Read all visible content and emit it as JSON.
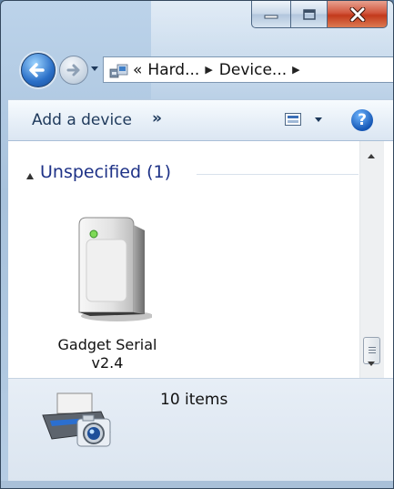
{
  "window": {
    "caption_buttons": {
      "minimize_icon": "minimize-icon",
      "maximize_icon": "maximize-icon",
      "close_icon": "close-icon",
      "close_color": "#c8432a"
    }
  },
  "navigation": {
    "back_icon": "back-arrow-icon",
    "forward_icon": "forward-arrow-icon",
    "history_icon": "dropdown-arrow-icon"
  },
  "address_bar": {
    "overflow_marker": "«",
    "breadcrumbs": [
      "Hard...",
      "Device..."
    ],
    "separator": "▶"
  },
  "toolbar": {
    "add_device_label": "Add a device",
    "more_label": "»",
    "view_icon": "change-view-icon",
    "help_icon": "help-icon",
    "help_glyph": "?"
  },
  "content": {
    "group_label": "Unspecified (1)",
    "devices": [
      {
        "label_line1": "Gadget Serial",
        "label_line2": "v2.4",
        "icon": "generic-device-icon"
      }
    ]
  },
  "details_pane": {
    "icon": "printer-camera-icon",
    "count_text": "10 items"
  },
  "colors": {
    "accent_group_text": "#1e3287",
    "toolbar_text": "#1e395b",
    "window_frame": "#a8c2dc"
  }
}
